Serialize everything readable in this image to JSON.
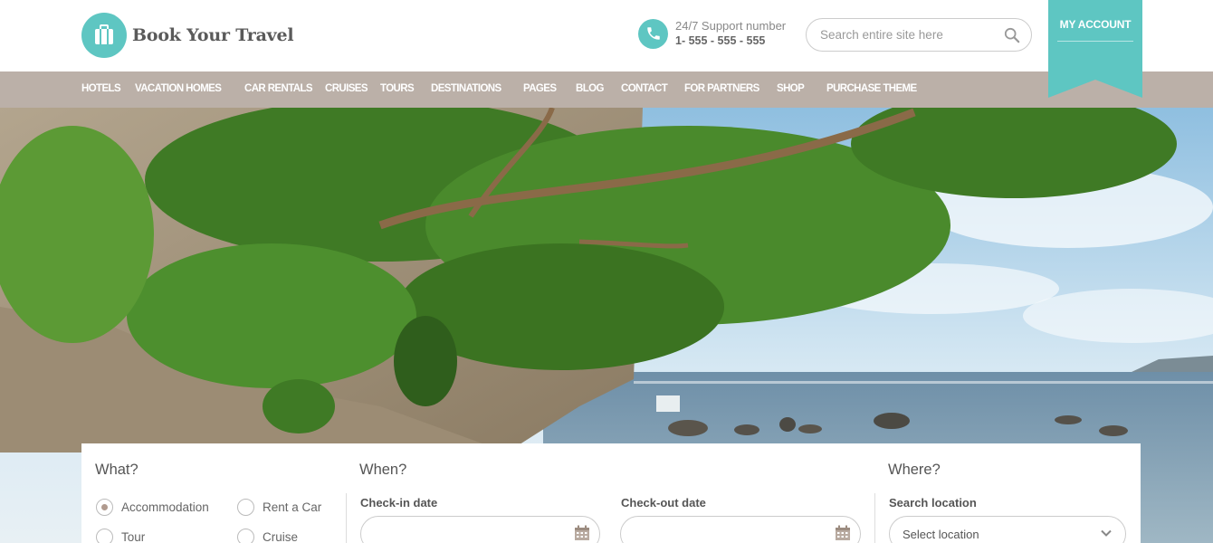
{
  "header": {
    "brand": "Book Your Travel",
    "support_label": "24/7 Support number",
    "support_number": "1- 555 - 555 - 555",
    "search_placeholder": "Search entire site here",
    "account_label": "MY ACCOUNT"
  },
  "nav": {
    "items": [
      "HOTELS",
      "VACATION HOMES",
      "CAR RENTALS",
      "CRUISES",
      "TOURS",
      "DESTINATIONS",
      "PAGES",
      "BLOG",
      "CONTACT",
      "FOR PARTNERS",
      "SHOP",
      "PURCHASE THEME"
    ]
  },
  "search": {
    "what_title": "What?",
    "when_title": "When?",
    "where_title": "Where?",
    "options": [
      "Accommodation",
      "Rent a Car",
      "Tour",
      "Cruise"
    ],
    "selected_option": "Accommodation",
    "checkin_label": "Check-in date",
    "checkout_label": "Check-out date",
    "location_label": "Search location",
    "location_value": "Select location"
  },
  "colors": {
    "accent": "#5ec6c2",
    "nav_bg": "#bbb0a8",
    "radio_dot": "#b09a8e"
  },
  "icons": [
    "suitcase-icon",
    "phone-icon",
    "search-icon",
    "calendar-icon",
    "chevron-down-icon"
  ]
}
